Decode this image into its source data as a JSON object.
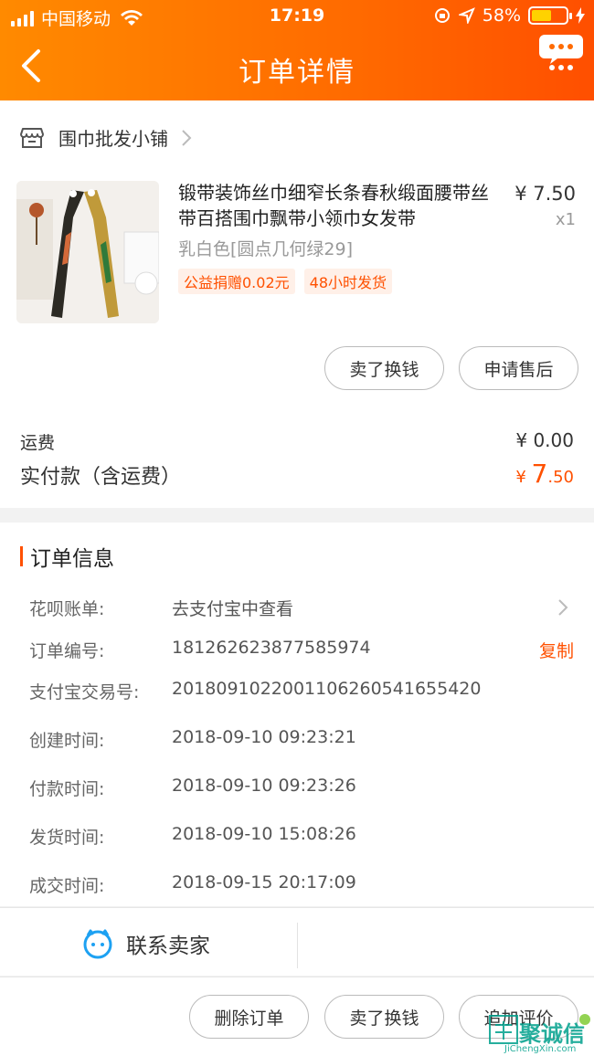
{
  "status_bar": {
    "carrier": "中国移动",
    "time": "17:19",
    "battery": "58%"
  },
  "nav": {
    "title": "订单详情"
  },
  "store": {
    "name": "围巾批发小铺"
  },
  "product": {
    "title": "锻带装饰丝巾细窄长条春秋缎面腰带丝带百搭围巾飘带小领巾女发带",
    "sku": "乳白色[圆点几何绿29]",
    "tags": [
      "公益捐赠0.02元",
      "48小时发货"
    ],
    "price": "¥ 7.50",
    "quantity": "x1",
    "actions": [
      "卖了换钱",
      "申请售后"
    ]
  },
  "totals": {
    "shipping_label": "运费",
    "shipping_value": "¥ 0.00",
    "paid_label": "实付款（含运费）",
    "paid_currency": "¥ ",
    "paid_int": "7",
    "paid_dec": ".50"
  },
  "order_info": {
    "title": "订单信息",
    "rows": [
      {
        "key": "花呗账单:",
        "value": "去支付宝中查看"
      },
      {
        "key": "订单编号:",
        "value": "181262623877585974"
      },
      {
        "key": "支付宝交易号:",
        "value": "2018091022001106260541655420"
      },
      {
        "key": "创建时间:",
        "value": "2018-09-10 09:23:21"
      },
      {
        "key": "付款时间:",
        "value": "2018-09-10 09:23:26"
      },
      {
        "key": "发货时间:",
        "value": "2018-09-10 15:08:26"
      },
      {
        "key": "成交时间:",
        "value": "2018-09-15 20:17:09"
      }
    ],
    "copy_label": "复制"
  },
  "contact": {
    "label": "联系卖家"
  },
  "bottom_actions": [
    "删除订单",
    "卖了换钱",
    "追加评价"
  ],
  "watermark": {
    "text": "聚诚信",
    "sub": "JiChengXin.com"
  },
  "colors": {
    "accent": "#ff5000",
    "header_start": "#ff8a00",
    "header_end": "#ff4f00"
  }
}
